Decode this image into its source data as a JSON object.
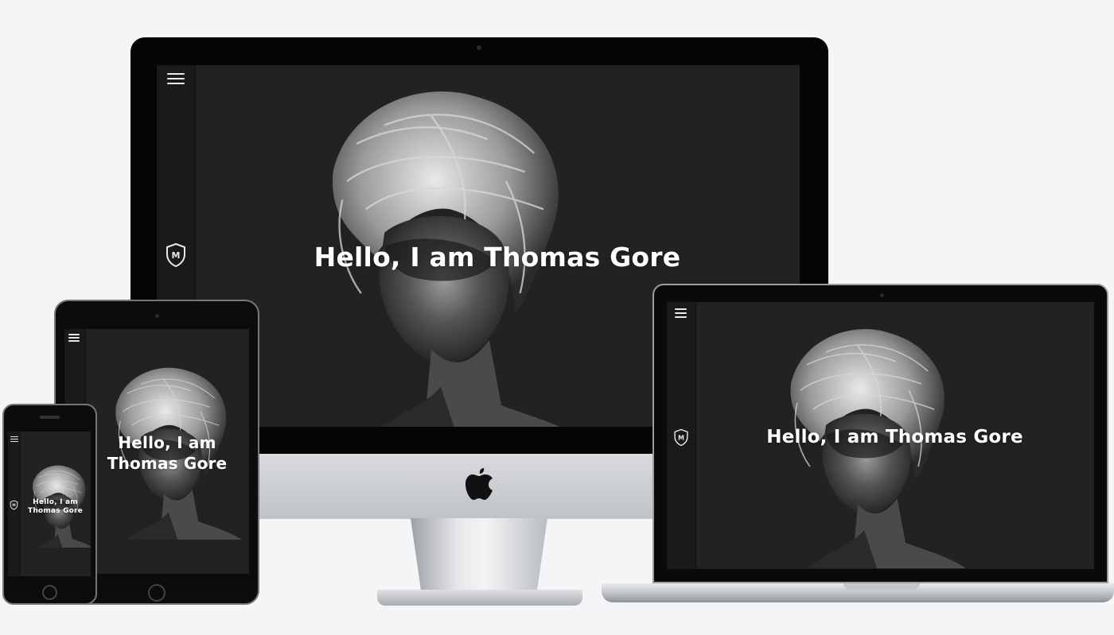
{
  "hero": {
    "title": "Hello, I am Thomas Gore",
    "title_line1": "Hello, I am",
    "title_line2": "Thomas Gore"
  },
  "brand": {
    "logo_letter": "M"
  },
  "icons": {
    "menu": "hamburger-menu-icon",
    "logo": "shield-logo-icon",
    "device_logo": "apple-logo-icon"
  },
  "colors": {
    "background": "#f4f5f7",
    "screen": "#222222",
    "sidebar": "#1a1a1a",
    "text": "#ffffff"
  }
}
